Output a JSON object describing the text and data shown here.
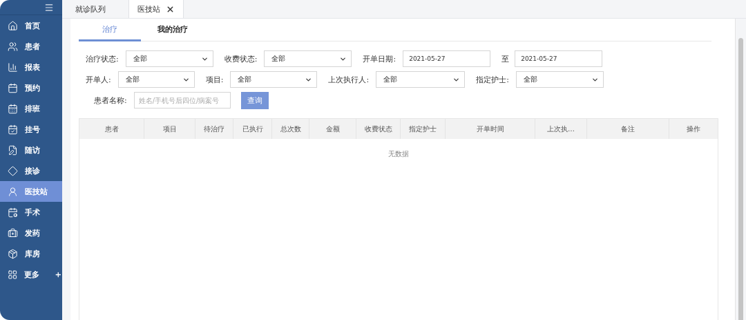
{
  "sidebar": {
    "items": [
      {
        "kind": "home",
        "label": "首页",
        "selected": false
      },
      {
        "kind": "users",
        "label": "患者",
        "selected": false
      },
      {
        "kind": "chart",
        "label": "报表",
        "selected": false
      },
      {
        "kind": "calendar",
        "label": "预约",
        "selected": false
      },
      {
        "kind": "schedule",
        "label": "排班",
        "selected": false
      },
      {
        "kind": "check",
        "label": "挂号",
        "selected": false
      },
      {
        "kind": "edit",
        "label": "随访",
        "selected": false
      },
      {
        "kind": "diamond",
        "label": "接诊",
        "selected": false
      },
      {
        "kind": "nurse",
        "label": "医技站",
        "selected": true
      },
      {
        "kind": "surgery",
        "label": "手术",
        "selected": false
      },
      {
        "kind": "medicine",
        "label": "发药",
        "selected": false
      },
      {
        "kind": "package",
        "label": "库房",
        "selected": false
      },
      {
        "kind": "more",
        "label": "更多",
        "selected": false
      }
    ]
  },
  "page_tabs": [
    {
      "label": "就诊队列",
      "selected": false,
      "closable": false
    },
    {
      "label": "医技站",
      "selected": true,
      "closable": true
    }
  ],
  "sub_tabs": [
    {
      "label": "治疗",
      "selected": true
    },
    {
      "label": "我的治疗",
      "selected": false
    }
  ],
  "filters": [
    [
      {
        "kind": "select",
        "label": "治疗状态:",
        "value": "全部"
      },
      {
        "kind": "select",
        "label": "收费状态:",
        "value": "全部"
      },
      {
        "kind": "date",
        "label": "开单日期:",
        "value": "2021-05-27"
      },
      {
        "kind": "date",
        "label": "至",
        "value": "2021-05-27"
      }
    ],
    [
      {
        "kind": "select",
        "label": "开单人:",
        "value": "全部"
      },
      {
        "kind": "select",
        "label": "项目:",
        "value": "全部"
      },
      {
        "kind": "select",
        "label": "上次执行人:",
        "value": "全部"
      },
      {
        "kind": "select",
        "label": "指定护士:",
        "value": "全部"
      }
    ],
    [
      {
        "kind": "text",
        "label": "患者名称:",
        "placeholder": "姓名/手机号后四位/病案号"
      },
      {
        "kind": "button",
        "label": "查询"
      }
    ]
  ],
  "table": {
    "columns": [
      "患者",
      "项目",
      "待治疗",
      "已执行",
      "总次数",
      "金额",
      "收费状态",
      "指定护士",
      "开单时间",
      "上次执…",
      "备注",
      "操作"
    ],
    "empty_text": "无数据"
  }
}
